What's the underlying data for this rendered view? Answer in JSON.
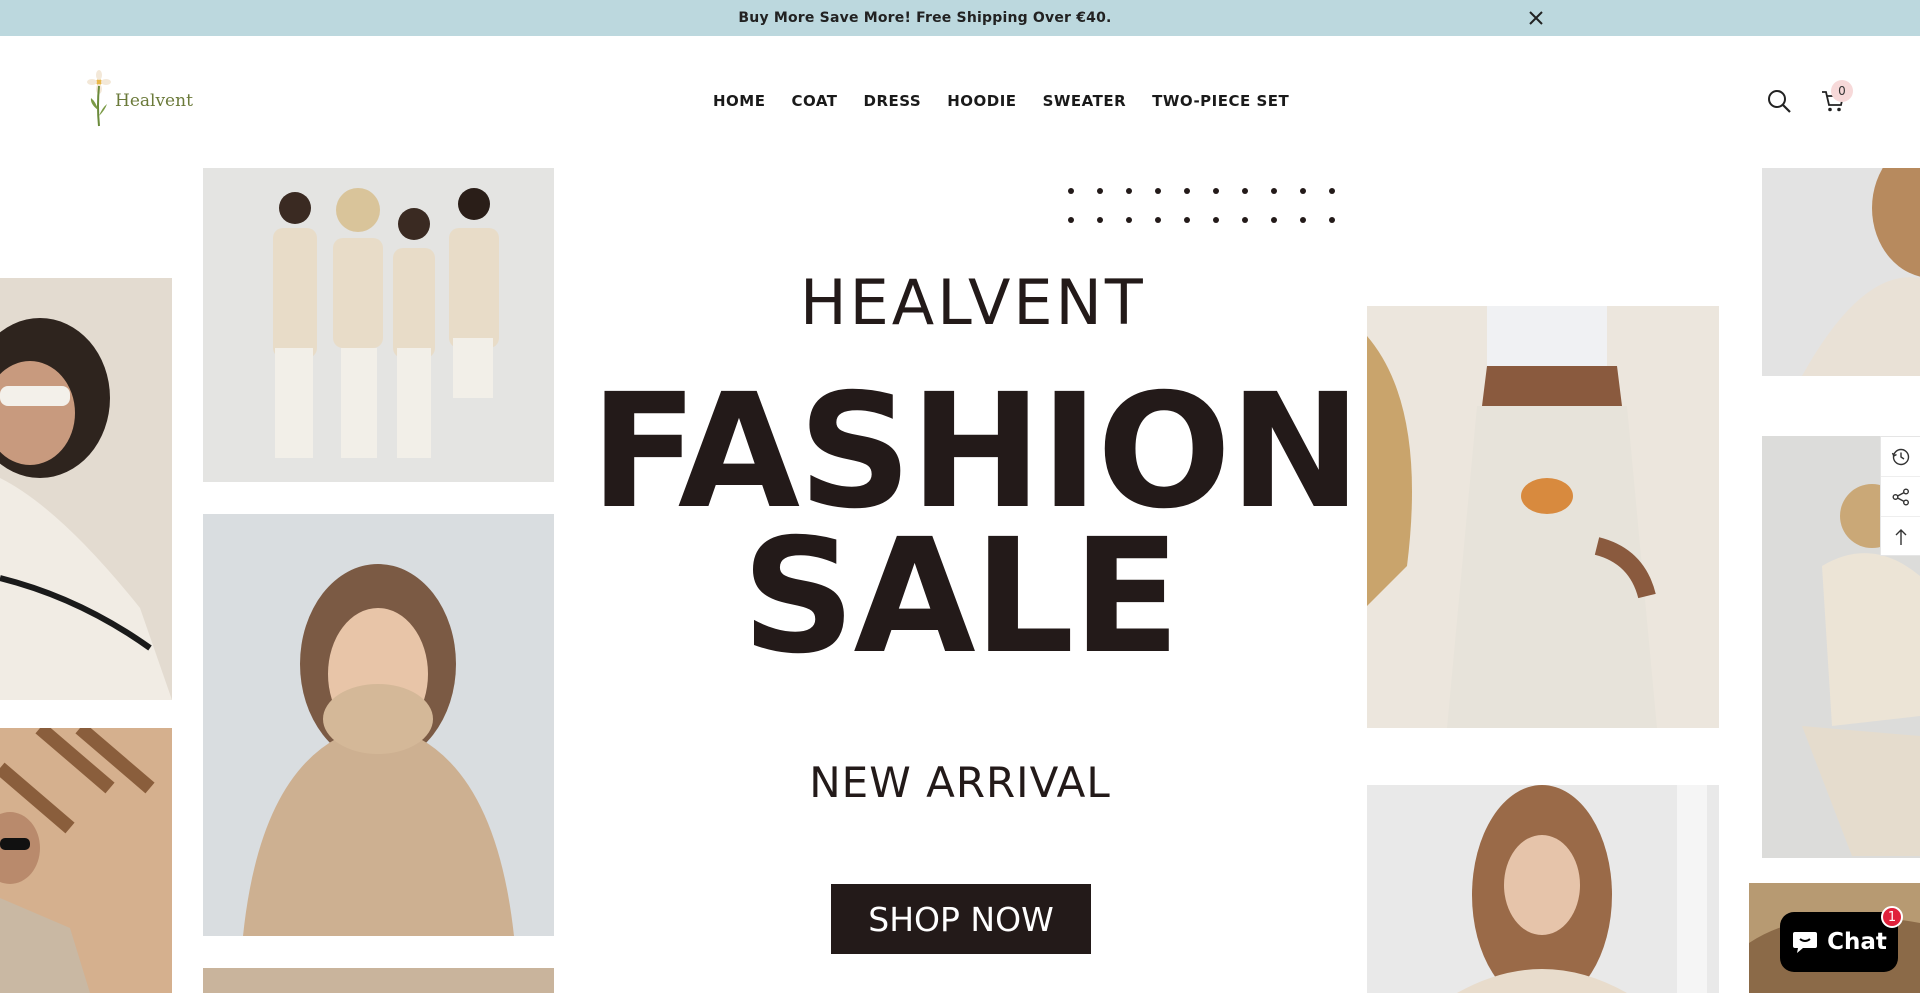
{
  "announcement": {
    "text": "Buy More Save More! Free Shipping Over €40."
  },
  "header": {
    "logo_text": "Healvent",
    "nav": [
      {
        "label": "HOME"
      },
      {
        "label": "COAT"
      },
      {
        "label": "DRESS"
      },
      {
        "label": "HOODIE"
      },
      {
        "label": "SWEATER"
      },
      {
        "label": "TWO-PIECE SET"
      }
    ],
    "cart_count": "0"
  },
  "hero": {
    "brand": "HEALVENT",
    "headline_1": "FASHION",
    "headline_2": "SALE",
    "subheadline": "NEW ARRIVAL",
    "cta_label": "SHOP NOW"
  },
  "chat": {
    "label": "Chat",
    "badge": "1"
  },
  "colors": {
    "announcement_bg": "#bcd8de",
    "text_dark": "#231a19",
    "chat_bg": "#000000",
    "chat_badge": "#e0203a"
  }
}
